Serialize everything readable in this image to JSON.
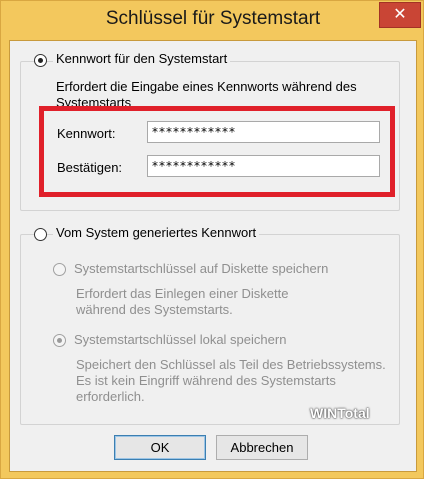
{
  "window": {
    "title": "Schlüssel für Systemstart",
    "close_glyph": "✕"
  },
  "option_password": {
    "label": "Kennwort für den Systemstart",
    "description": "Erfordert die Eingabe eines Kennworts während des Systemstarts",
    "password_label": "Kennwort:",
    "password_value": "************",
    "confirm_label": "Bestätigen:",
    "confirm_value": "************",
    "selected": true
  },
  "option_generated": {
    "label": "Vom System generiertes Kennwort",
    "selected": false,
    "sub_floppy": {
      "label": "Systemstartschlüssel auf Diskette speichern",
      "description": "Erfordert das Einlegen einer Diskette während des Systemstarts."
    },
    "sub_local": {
      "label": "Systemstartschlüssel lokal speichern",
      "description": "Speichert den Schlüssel als Teil des Betriebssystems. Es ist kein Eingriff während des Systemstarts erforderlich."
    }
  },
  "buttons": {
    "ok": "OK",
    "cancel": "Abbrechen"
  },
  "watermark": "WINTotal",
  "colors": {
    "highlight": "#e0202a",
    "title_bar": "#f3c85d",
    "close_button": "#c94535"
  }
}
